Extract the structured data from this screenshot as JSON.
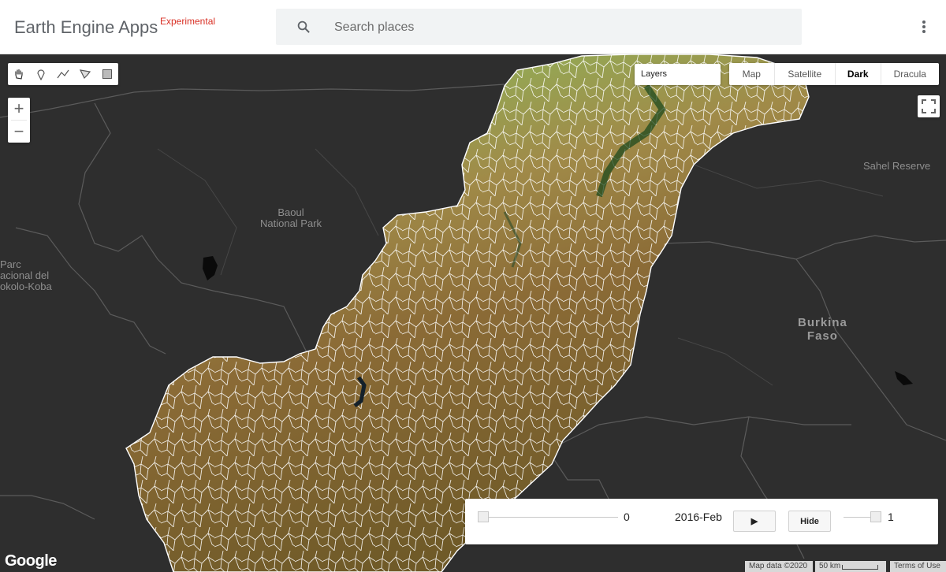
{
  "header": {
    "brand": "Earth Engine Apps",
    "badge": "Experimental",
    "search": {
      "placeholder": "Search places",
      "icon": "search-icon"
    },
    "menu_icon": "more-vert-icon"
  },
  "map": {
    "labels": {
      "baoul": "Baoul\nNational Park",
      "parc": "Parc\nacional del\nokolo-Koba",
      "sahel": "Sahel Reserve",
      "burkina": "Burkina\nFaso"
    },
    "drawing_tools": [
      "pan-hand-icon",
      "point-marker-icon",
      "line-icon",
      "polygon-icon",
      "rectangle-icon"
    ],
    "zoom": {
      "in": "+",
      "out": "−"
    },
    "layers_label": "Layers",
    "map_types": [
      "Map",
      "Satellite",
      "Dark",
      "Dracula"
    ],
    "active_map_type": "Dark",
    "fullscreen_icon": "fullscreen-icon"
  },
  "timeline": {
    "start_value": "0",
    "date": "2016-Feb",
    "play_label": "▶",
    "hide_label": "Hide",
    "opacity_value": "1",
    "frame_slider_position": 0,
    "opacity_slider_position": 1
  },
  "footer": {
    "google": "Google",
    "map_data": "Map data ©2020",
    "scale": "50 km",
    "terms": "Terms of Use"
  },
  "colors": {
    "map_background": "#2e2e2e",
    "basin_border": "#ffffff",
    "brand_badge": "#d93025"
  }
}
